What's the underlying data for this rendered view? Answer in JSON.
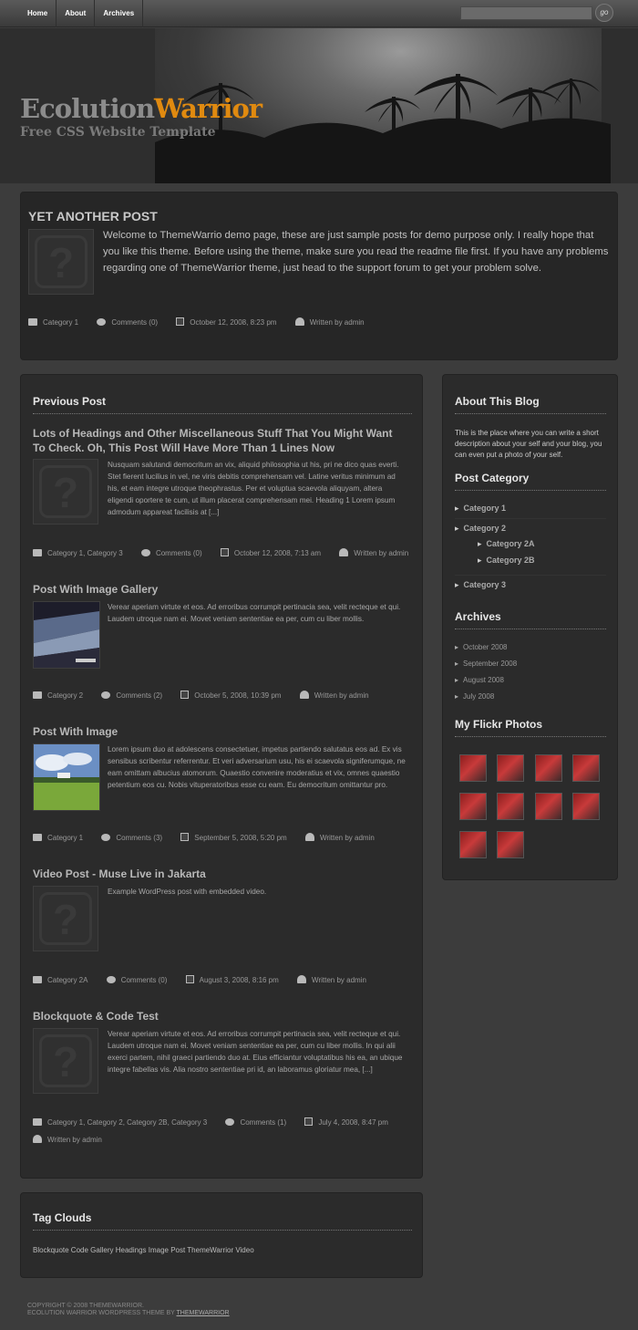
{
  "nav": {
    "items": [
      "Home",
      "About",
      "Archives"
    ],
    "search_placeholder": "",
    "go_label": "go"
  },
  "header": {
    "logo_part1": "Ecolution",
    "logo_part2": "Warrior",
    "tagline": "Free CSS Website Template"
  },
  "featured": {
    "title": "YET ANOTHER POST",
    "excerpt": "Welcome to ThemeWarrio demo page, these are just sample posts for demo purpose only. I really hope that you like this theme. Before using the theme, make sure you read the readme file first. If you have any problems regarding one of ThemeWarrior theme, just head to the support forum to get your problem solve.",
    "category": "Category 1",
    "comments": "Comments (0)",
    "date": "October 12, 2008, 8:23 pm",
    "author": "Written by admin"
  },
  "main": {
    "heading": "Previous Post",
    "posts": [
      {
        "title": "Lots of Headings and Other Miscellaneous Stuff That You Might Want To Check. Oh, This Post Will Have More Than 1 Lines Now",
        "excerpt": "Nusquam salutandi democritum an vix, aliquid philosophia ut his, pri ne dico quas everti. Stet fierent lucilius in vel, ne viris debitis comprehensam vel. Latine veritus minimum ad his, et eam integre utroque theophrastus. Per et voluptua scaevola aliquyam, altera eligendi oportere te cum, ut illum placerat comprehensam mei. Heading 1 Lorem ipsum admodum appareat facilisis at [...]",
        "category": "Category 1, Category 3",
        "comments": "Comments (0)",
        "date": "October 12, 2008, 7:13 am",
        "author": "Written by admin"
      },
      {
        "title": "Post With Image Gallery",
        "excerpt": "Verear aperiam virtute et eos. Ad erroribus corrumpit pertinacia sea, velit recteque et qui. Laudem utroque nam ei. Movet veniam sententiae ea per, cum cu liber mollis.",
        "category": "Category 2",
        "comments": "Comments (2)",
        "date": "October 5, 2008, 10:39 pm",
        "author": "Written by admin"
      },
      {
        "title": "Post With Image",
        "excerpt": "Lorem ipsum duo at adolescens consectetuer, impetus partiendo salutatus eos ad. Ex vis sensibus scribentur referrentur. Et veri adversarium usu, his ei scaevola signiferumque, ne eam omittam albucius atomorum. Quaestio convenire moderatius et vix, omnes quaestio petentium eos cu. Nobis vituperatoribus esse cu eam. Eu democritum omittantur pro.",
        "category": "Category 1",
        "comments": "Comments (3)",
        "date": "September 5, 2008, 5:20 pm",
        "author": "Written by admin"
      },
      {
        "title": "Video Post - Muse Live in Jakarta",
        "excerpt": "Example WordPress post with embedded video.",
        "category": "Category 2A",
        "comments": "Comments (0)",
        "date": "August 3, 2008, 8:16 pm",
        "author": "Written by admin"
      },
      {
        "title": "Blockquote & Code Test",
        "excerpt": "Verear aperiam virtute et eos. Ad erroribus corrumpit pertinacia sea, velit recteque et qui. Laudem utroque nam ei. Movet veniam sententiae ea per, cum cu liber mollis. In qui alii exerci partem, nihil graeci partiendo duo at. Eius efficiantur voluptatibus his ea, an ubique integre fabellas vis. Alia nostro sententiae pri id, an laboramus gloriatur mea, [...]",
        "category": "Category 1, Category 2, Category 2B, Category 3",
        "comments": "Comments (1)",
        "date": "July 4, 2008, 8:47 pm",
        "author": "Written by admin"
      }
    ]
  },
  "sidebar": {
    "about_heading": "About This Blog",
    "about_text": "This is the place where you can write a short description about your self and your blog, you can even put a photo of your self.",
    "category_heading": "Post Category",
    "categories": [
      "Category 1",
      "Category 2",
      "Category 2A",
      "Category 2B",
      "Category 3"
    ],
    "archives_heading": "Archives",
    "archives": [
      "October 2008",
      "September 2008",
      "August 2008",
      "July 2008"
    ],
    "flickr_heading": "My Flickr Photos"
  },
  "tags": {
    "heading": "Tag Clouds",
    "list": "Blockquote Code Gallery Headings Image Post ThemeWarrior Video"
  },
  "footer": {
    "line1": "COPYRIGHT © 2008 THEMEWARRIOR.",
    "line2_prefix": "ECOLUTION WARRIOR WORDPRESS THEME BY",
    "line2_link": "THEMEWARRIOR"
  }
}
